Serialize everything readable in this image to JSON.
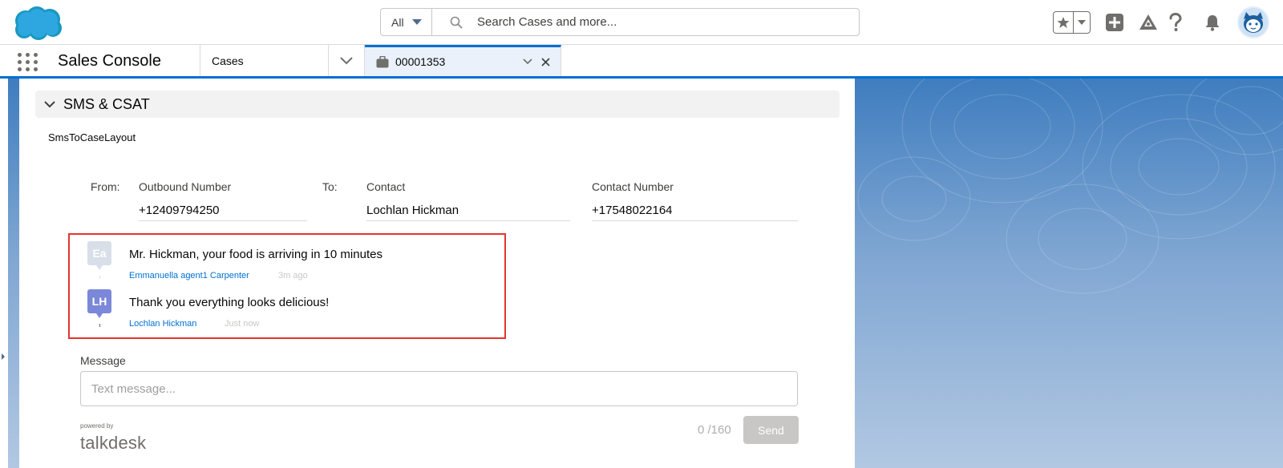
{
  "header": {
    "search": {
      "scope": "All",
      "placeholder": "Search Cases and more..."
    },
    "icons": [
      "salesforce-cloud-logo",
      "star-icon",
      "chevron-down-icon",
      "plus-icon",
      "trailhead-icon",
      "help-icon",
      "bell-icon",
      "avatar"
    ]
  },
  "context_bar": {
    "app_name": "Sales Console",
    "nav_item": "Cases",
    "tab_label": "00001353"
  },
  "section": {
    "title": "SMS & CSAT",
    "layout_name": "SmsToCaseLayout"
  },
  "fields": {
    "from_label": "From:",
    "outbound_label": "Outbound Number",
    "outbound_value": "+12409794250",
    "to_label": "To:",
    "contact_label": "Contact",
    "contact_value": "Lochlan Hickman",
    "contact_number_label": "Contact Number",
    "contact_number_value": "+17548022164"
  },
  "messages": [
    {
      "initials": "Ea",
      "text": "Mr. Hickman, your food is arriving in 10 minutes",
      "author": "Emmanuella agent1 Carpenter",
      "time": "3m ago"
    },
    {
      "initials": "LH",
      "text": "Thank you everything looks delicious!",
      "author": "Lochlan Hickman",
      "time": "Just now"
    }
  ],
  "composer": {
    "label": "Message",
    "placeholder": "Text message...",
    "counter": "0 /160",
    "send": "Send",
    "powered_by": "powered by",
    "brand": "talkdesk"
  },
  "colors": {
    "brand_blue": "#0070d2",
    "highlight_border": "#e3352a",
    "agent_avatar": "#d8dfe8",
    "contact_avatar": "#7b88d9"
  }
}
